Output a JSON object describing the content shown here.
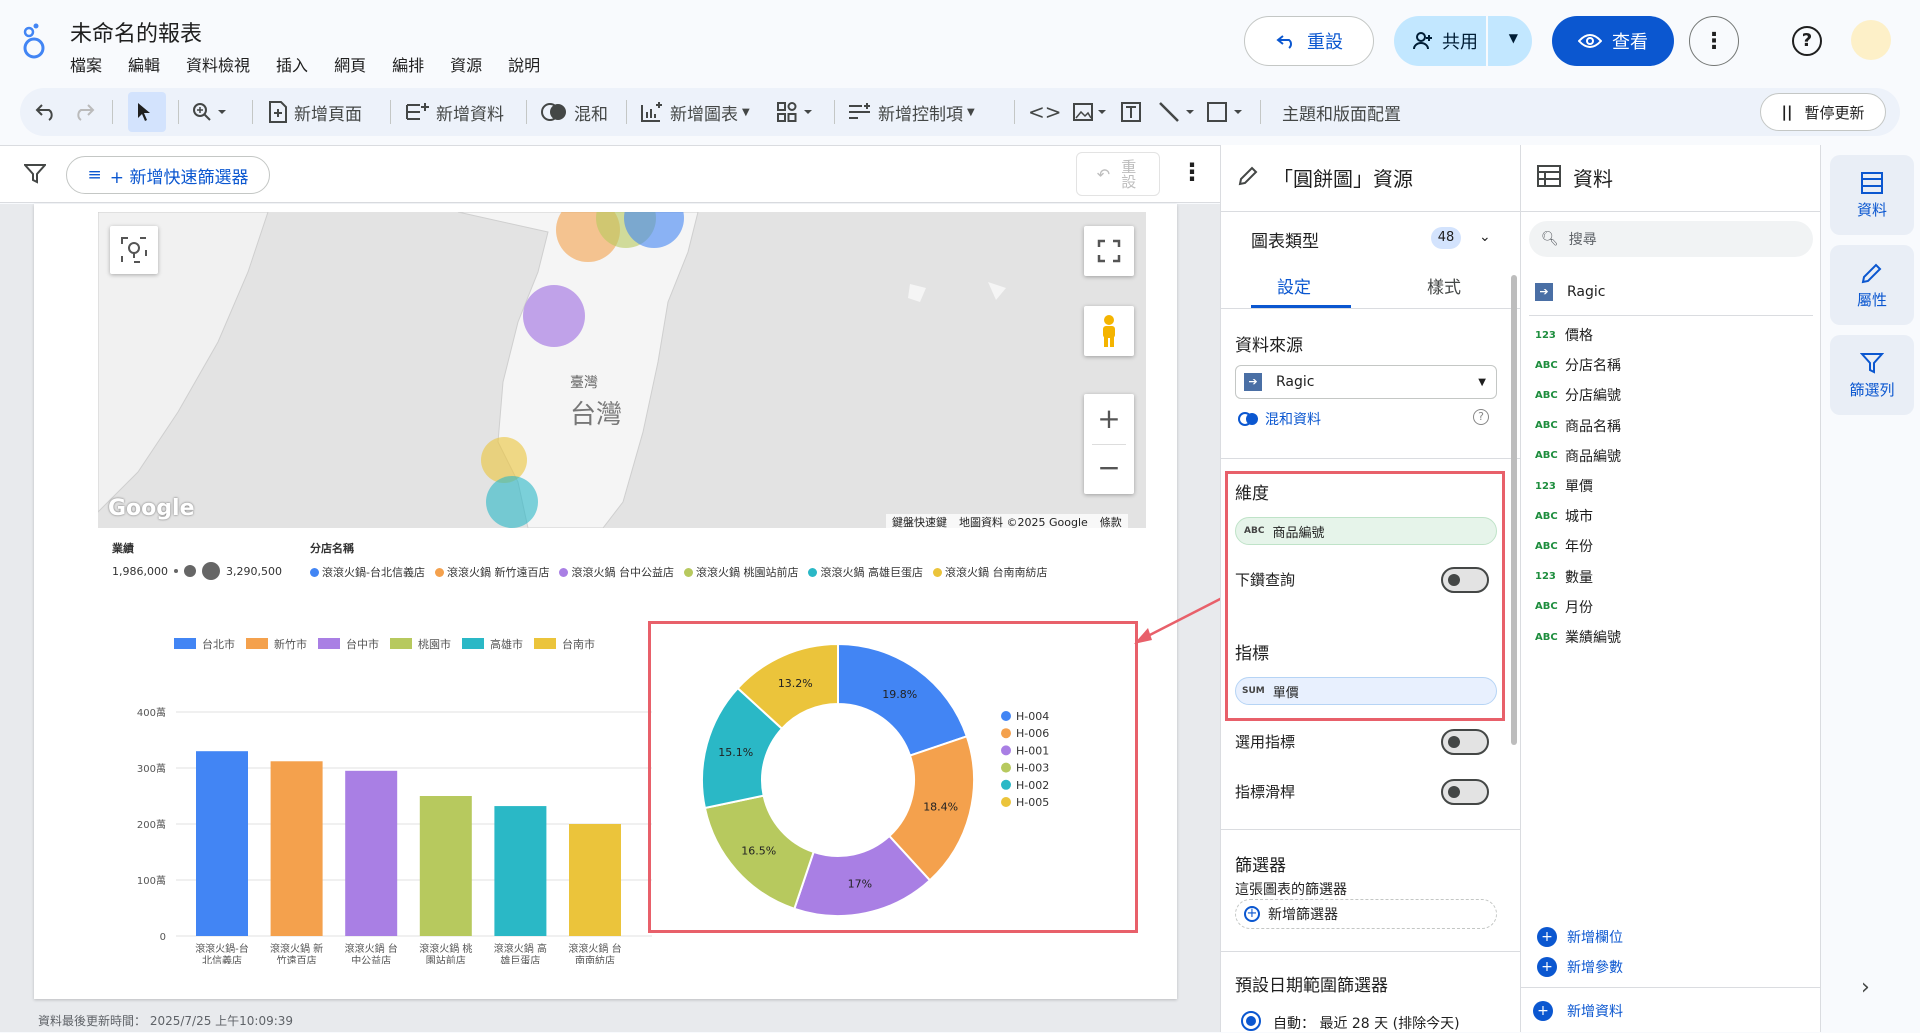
{
  "app": {
    "title": "未命名的報表",
    "menu": [
      "檔案",
      "編輯",
      "資料檢視",
      "插入",
      "網頁",
      "編排",
      "資源",
      "說明"
    ],
    "reset_label": "重設",
    "share_label": "共用",
    "view_label": "查看"
  },
  "toolbar": {
    "add_page": "新增頁面",
    "add_data": "新增資料",
    "blend": "混和",
    "add_chart": "新增圖表",
    "add_control": "新增控制項",
    "theme": "主題和版面配置",
    "pause": "暫停更新"
  },
  "filterbar": {
    "quick_filter": "+ 新增快速篩選器",
    "reset": "重設"
  },
  "map": {
    "label_taiwan": "台灣",
    "label_taiwan_small": "臺灣",
    "google": "Google",
    "attribution_keys": "鍵盤快速鍵",
    "attribution_data": "地圖資料 ©2025 Google",
    "attribution_terms": "條款",
    "legend_size_title": "業績",
    "legend_size_min": "1,986,000",
    "legend_size_max": "3,290,500",
    "legend_color_title": "分店名稱",
    "legend_items": [
      {
        "label": "滾滾火鍋-台北信義店",
        "color": "#4285f4"
      },
      {
        "label": "滾滾火鍋 新竹遠百店",
        "color": "#f4a14d"
      },
      {
        "label": "滾滾火鍋 台中公益店",
        "color": "#a97fe4"
      },
      {
        "label": "滾滾火鍋 桃園站前店",
        "color": "#b7c95e"
      },
      {
        "label": "滾滾火鍋 高雄巨蛋店",
        "color": "#2ab8c6"
      },
      {
        "label": "滾滾火鍋 台南南紡店",
        "color": "#ebc43b"
      }
    ]
  },
  "chart_data": [
    {
      "type": "bar",
      "legend": [
        "台北市",
        "新竹市",
        "台中市",
        "桃園市",
        "高雄市",
        "台南市"
      ],
      "categories": [
        "滾滾火鍋-台北信義店",
        "滾滾火鍋 新竹遠百店",
        "滾滾火鍋 台中公益店",
        "滾滾火鍋 桃園站前店",
        "滾滾火鍋 高雄巨蛋店",
        "滾滾火鍋 台南南紡店"
      ],
      "values": [
        3300000,
        3120000,
        2950000,
        2500000,
        2320000,
        2000000
      ],
      "colors": [
        "#4285f4",
        "#f4a14d",
        "#a97fe4",
        "#b7c95e",
        "#2ab8c6",
        "#ebc43b"
      ],
      "yticks": [
        "0",
        "100萬",
        "200萬",
        "300萬",
        "400萬"
      ],
      "ylim": [
        0,
        4000000
      ],
      "legend_position": "top"
    },
    {
      "type": "pie",
      "donut": true,
      "labels": [
        "H-004",
        "H-006",
        "H-001",
        "H-003",
        "H-002",
        "H-005"
      ],
      "values": [
        19.8,
        18.4,
        17,
        16.5,
        15.1,
        13.2
      ],
      "value_labels": [
        "19.8%",
        "18.4%",
        "17%",
        "16.5%",
        "15.1%",
        "13.2%"
      ],
      "colors": [
        "#4285f4",
        "#f4a14d",
        "#a97fe4",
        "#b7c95e",
        "#2ab8c6",
        "#ebc43b"
      ],
      "legend_position": "right"
    }
  ],
  "status": "資料最後更新時間： 2025/7/25 上午10:09:39",
  "props_panel": {
    "title": "「圓餅圖」資源",
    "chart_type_label": "圖表類型",
    "chart_type_count": "48",
    "tab_setup": "設定",
    "tab_style": "樣式",
    "data_source_label": "資料來源",
    "data_source_value": "Ragic",
    "blend_label": "混和資料",
    "dimension_label": "維度",
    "dimension_type": "ABC",
    "dimension_value": "商品編號",
    "drilldown_label": "下鑽查詢",
    "metric_label": "指標",
    "metric_type": "SUM",
    "metric_value": "單價",
    "optional_metrics": "選用指標",
    "metric_slider": "指標滑桿",
    "filter_label": "篩選器",
    "filter_desc": "這張圖表的篩選器",
    "add_filter": "新增篩選器",
    "date_range_label": "預設日期範圍篩選器",
    "date_range_value": "自動： 最近 28 天 (排除今天)"
  },
  "data_panel": {
    "title": "資料",
    "search_placeholder": "搜尋",
    "source": "Ragic",
    "fields": [
      {
        "type": "123",
        "name": "價格"
      },
      {
        "type": "ABC",
        "name": "分店名稱"
      },
      {
        "type": "ABC",
        "name": "分店編號"
      },
      {
        "type": "ABC",
        "name": "商品名稱"
      },
      {
        "type": "ABC",
        "name": "商品編號"
      },
      {
        "type": "123",
        "name": "單價"
      },
      {
        "type": "ABC",
        "name": "城市"
      },
      {
        "type": "ABC",
        "name": "年份"
      },
      {
        "type": "123",
        "name": "數量"
      },
      {
        "type": "ABC",
        "name": "月份"
      },
      {
        "type": "ABC",
        "name": "業績編號"
      }
    ],
    "add_field": "新增欄位",
    "add_param": "新增參數",
    "add_data": "新增資料"
  },
  "right_sidebar": {
    "data_tab": "資料",
    "props_tab": "屬性",
    "filter_tab": "篩選列"
  },
  "colors": {
    "accent": "#0b57d0",
    "highlight": "#e8606a"
  }
}
